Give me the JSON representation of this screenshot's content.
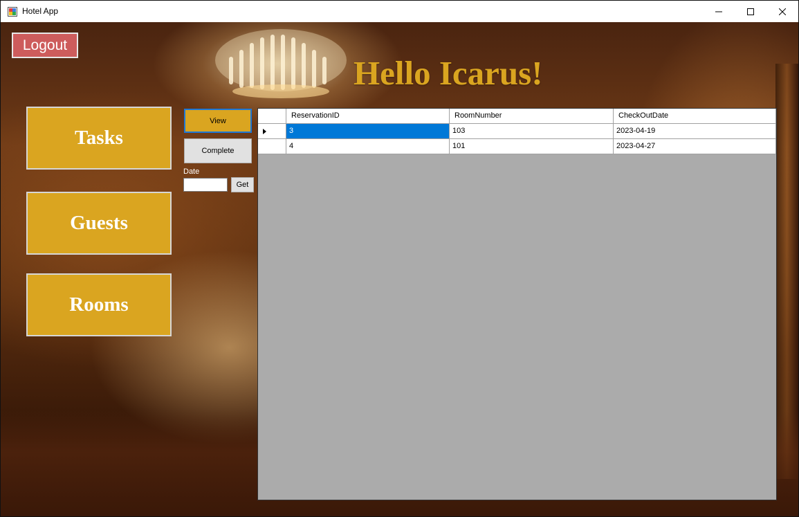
{
  "window": {
    "title": "Hotel App"
  },
  "header": {
    "logout_label": "Logout",
    "greeting": "Hello Icarus!"
  },
  "nav": {
    "tasks_label": "Tasks",
    "guests_label": "Guests",
    "rooms_label": "Rooms"
  },
  "actions": {
    "view_label": "View",
    "complete_label": "Complete",
    "date_label": "Date",
    "date_value": "",
    "get_label": "Get"
  },
  "table": {
    "columns": [
      "ReservationID",
      "RoomNumber",
      "CheckOutDate"
    ],
    "rows": [
      {
        "reservation_id": "3",
        "room_number": "103",
        "checkout_date": "2023-04-19"
      },
      {
        "reservation_id": "4",
        "room_number": "101",
        "checkout_date": "2023-04-27"
      }
    ]
  },
  "colors": {
    "accent_gold": "#daa520",
    "logout_red": "#cd5c5c",
    "selection_blue": "#0078d7",
    "grid_background": "#ababab"
  },
  "icons": {
    "app": "app-window-icon",
    "minimize": "minimize-icon",
    "maximize": "maximize-icon",
    "close": "close-icon",
    "row_indicator": "row-pointer-icon"
  }
}
